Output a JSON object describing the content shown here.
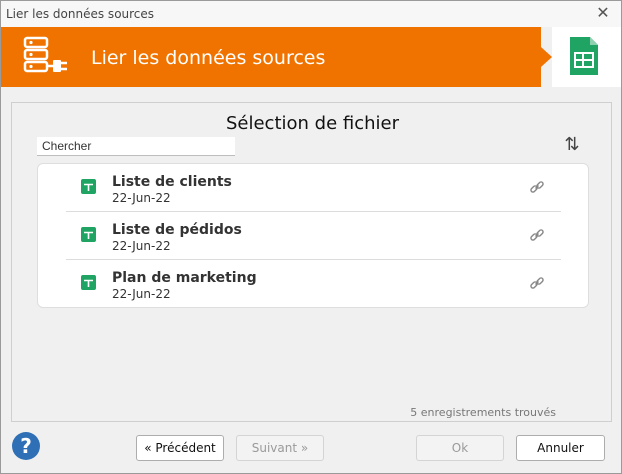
{
  "window": {
    "title": "Lier les données sources"
  },
  "banner": {
    "title": "Lier les données sources",
    "accent": "#f07300"
  },
  "panel": {
    "title": "Sélection de fichier",
    "search_placeholder": "Chercher",
    "items": [
      {
        "name": "Liste de clients",
        "date": "22-Jun-22"
      },
      {
        "name": "Liste de pédidos",
        "date": "22-Jun-22"
      },
      {
        "name": "Plan de marketing",
        "date": "22-Jun-22"
      }
    ],
    "count_text": "5 enregistrements trouvés"
  },
  "buttons": {
    "prev": "« Précédent",
    "next": "Suivant »",
    "ok": "Ok",
    "cancel": "Annuler"
  },
  "icons": {
    "close": "close-icon",
    "banner": "database-plug-icon",
    "sheets": "google-sheets-icon",
    "sort": "sort-arrows-icon",
    "link": "link-icon",
    "help": "help-icon"
  },
  "colors": {
    "sheets_green": "#1fa463",
    "help_blue": "#2f6fb5"
  }
}
